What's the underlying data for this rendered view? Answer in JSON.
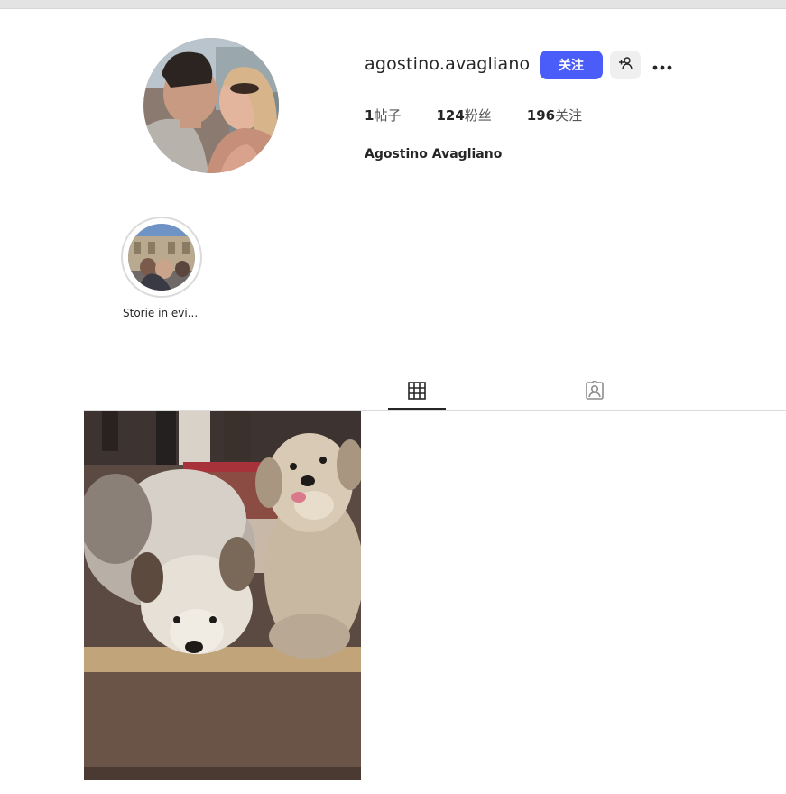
{
  "profile": {
    "username": "agostino.avagliano",
    "full_name": "Agostino Avagliano",
    "avatar_icon": "profile-photo"
  },
  "actions": {
    "follow_label": "关注",
    "add_user_icon": "add-user-icon",
    "more_icon": "more-horizontal-icon"
  },
  "stats": {
    "posts": {
      "count": "1",
      "label": "帖子"
    },
    "followers": {
      "count": "124",
      "label": "粉丝"
    },
    "following": {
      "count": "196",
      "label": "关注"
    }
  },
  "highlights": [
    {
      "label": "Storie in evi..."
    }
  ],
  "tabs": [
    {
      "name": "posts",
      "icon": "grid-icon",
      "active": true
    },
    {
      "name": "tagged",
      "icon": "tagged-icon",
      "active": false
    }
  ],
  "colors": {
    "accent": "#4a5df9",
    "text": "#262626",
    "divider": "#dbdbdb"
  }
}
